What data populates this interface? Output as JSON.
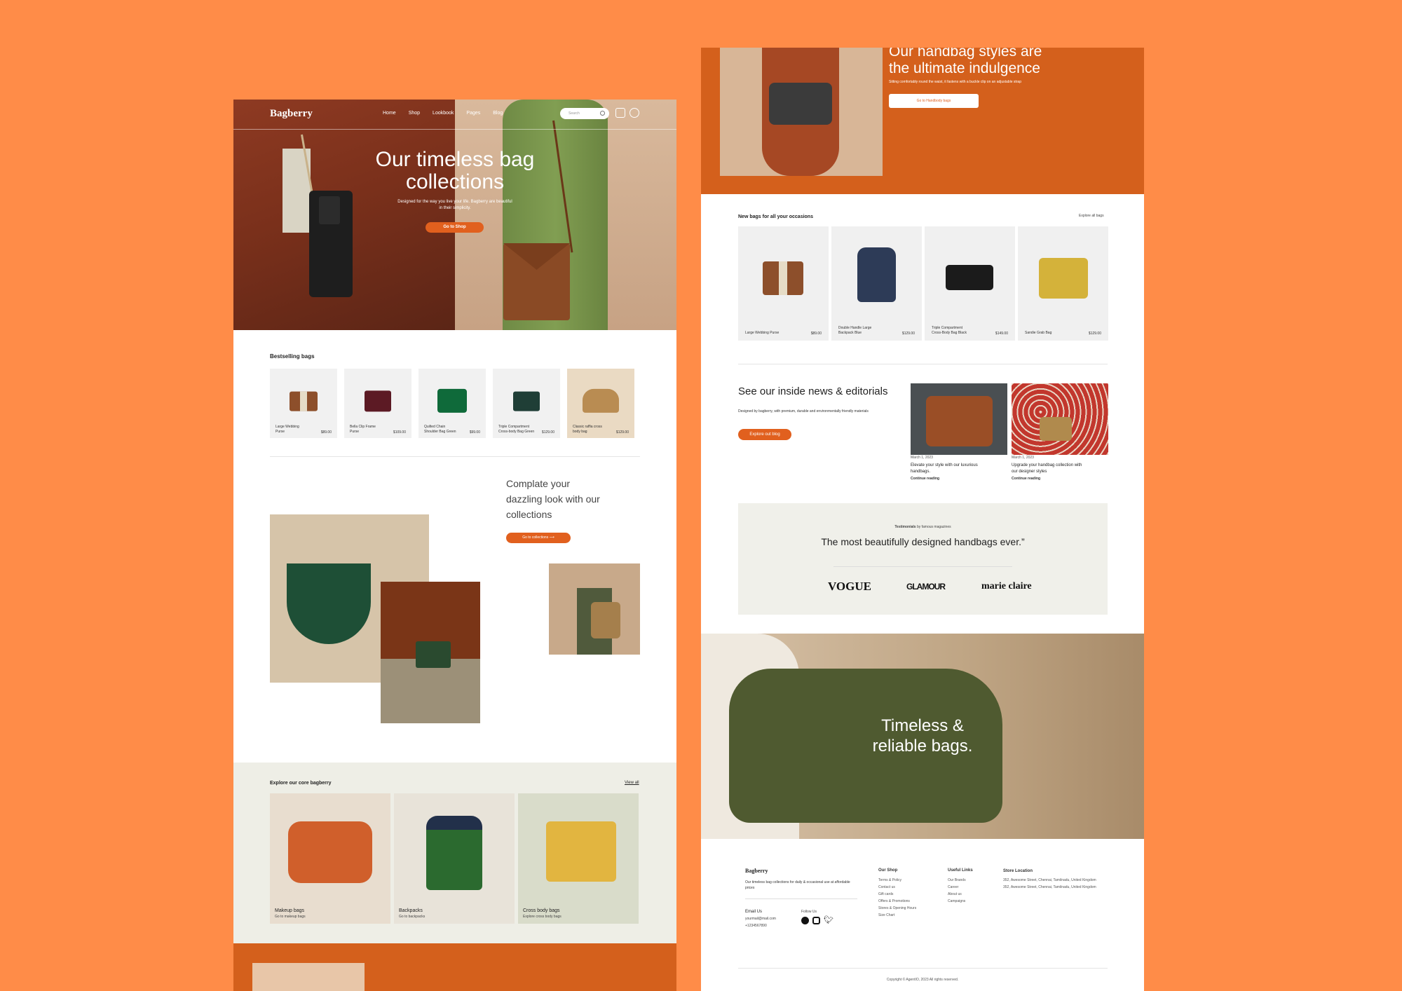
{
  "colors": {
    "background": "#FF8C48",
    "accent": "#E1601E",
    "band": "#D4601C",
    "card": "#F1F1F1",
    "explore_bg": "#EEEEE6"
  },
  "hero": {
    "logo": "Bagberry",
    "nav": [
      "Home",
      "Shop",
      "Lookbook",
      "Pages",
      "Blog"
    ],
    "search_placeholder": "Search",
    "title_line1": "Our timeless bag",
    "title_line2": "collections",
    "subtitle": "Designed for the way you live your life. Bagberry are beautiful in their simplicity.",
    "cta": "Go to Shop"
  },
  "bestselling": {
    "title": "Bestselling bags",
    "items": [
      {
        "name_line1": "Large Webbing",
        "name_line2": "Purse",
        "price": "$89.00"
      },
      {
        "name_line1": "Bella Clip Frame",
        "name_line2": "Purse",
        "price": "$109.00"
      },
      {
        "name_line1": "Quilted Chain",
        "name_line2": "Shoulder Bag Green",
        "price": "$99.00"
      },
      {
        "name_line1": "Triple Compartment",
        "name_line2": "Cross-body Bag Green",
        "price": "$129.00"
      },
      {
        "name_line1": "Classic raffia cross",
        "name_line2": "body bag",
        "price": "$129.00"
      }
    ]
  },
  "complete": {
    "line1": "Complate your",
    "line2": "dazzling look with our",
    "line3": "collections",
    "cta": "Go to collections"
  },
  "explore": {
    "title": "Explore our core bagberry",
    "view_all": "View all",
    "items": [
      {
        "title": "Makeup bags",
        "sub": "Go to makeup bags"
      },
      {
        "title": "Backpacks",
        "sub": "Go to backpacks"
      },
      {
        "title": "Cross body bags",
        "sub": "Explore cross body bags"
      }
    ]
  },
  "handbag": {
    "title_line1": "Our handbag styles are",
    "title_line2": "the ultimate indulgence",
    "sub": "Sitting comfortably round the waist, it fastens with a buckle clip on an adjustable strap",
    "cta": "Go to Handbody bags"
  },
  "new_bags": {
    "title": "New bags for all your occasions",
    "explore": "Explore all bags",
    "items": [
      {
        "name_line1": "Large Webbing Purse",
        "name_line2": "",
        "price": "$89.00"
      },
      {
        "name_line1": "Double Handle Large",
        "name_line2": "Backpack Blue",
        "price": "$129.00"
      },
      {
        "name_line1": "Triple Compartment",
        "name_line2": "Cross-Body Bag Black",
        "price": "$149.00"
      },
      {
        "name_line1": "Sandie Grab Bag",
        "name_line2": "",
        "price": "$129.00"
      }
    ]
  },
  "news": {
    "title": "See our inside news & editorials",
    "sub": "Designed by bagberry, with premium, durable and environmentally friendly materials",
    "cta": "Explore out blog",
    "posts": [
      {
        "date": "March 1, 2023",
        "title_line1": "Elevate your style with our luxurious",
        "title_line2": "handbags.",
        "link": "Continue reading"
      },
      {
        "date": "March 1, 2023",
        "title_line1": "Upgrade your handbag collection with",
        "title_line2": "our designer styles",
        "link": "Continue reading"
      }
    ]
  },
  "testimonials": {
    "label_bold": "Testimonials",
    "label_rest": " by famous magazines",
    "quote": "The most beautifully designed handbags ever.”",
    "logos": [
      "VOGUE",
      "GLAMOUR",
      "marie claire"
    ]
  },
  "banner": {
    "line1": "Timeless &",
    "line2": "reliable bags."
  },
  "footer": {
    "logo": "Bagberry",
    "tagline": "Our timeless bag collections for daily & occasional use at affordable prices",
    "email_h": "Email Us",
    "email": "yourmail@mail.com",
    "phone": "+1234567890",
    "follow_h": "Follow Us",
    "shop_h": "Our Shop",
    "shop": [
      "Terms & Policy",
      "Contact us",
      "Gift cards",
      "Offers & Promotions",
      "Stores & Opening Hours",
      "Size Chart"
    ],
    "links_h": "Useful Links",
    "links": [
      "Our Brands",
      "Career",
      "About us",
      "Campaigns"
    ],
    "store_h": "Store Location",
    "stores": [
      "352, Awesome Street, Chennai, Tamilnadu, United Kingdom",
      "352, Awesome Street, Chennai, Tamilnadu, United Kingdom"
    ],
    "copyright": "Copyright © AgentIO, 2023 All rights reserved."
  }
}
